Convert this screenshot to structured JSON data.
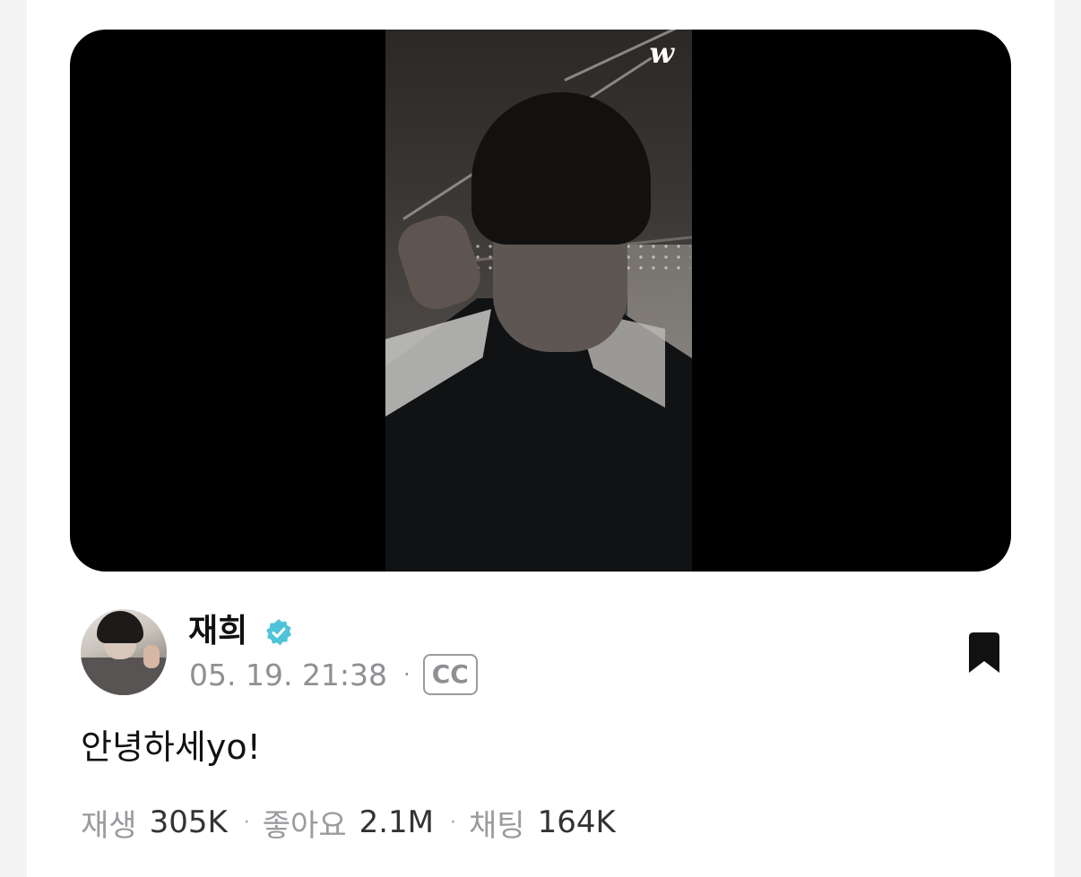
{
  "video": {
    "watermark": "w"
  },
  "post": {
    "author": "재희",
    "verified_icon": "verified-badge-icon",
    "date": "05. 19. 21:38",
    "separator": "·",
    "cc_label": "CC",
    "bookmark_icon": "bookmark-icon",
    "caption": "안녕하세yo!"
  },
  "stats": {
    "plays_label": "재생",
    "plays_value": "305K",
    "likes_label": "좋아요",
    "likes_value": "2.1M",
    "chats_label": "채팅",
    "chats_value": "164K",
    "separator": "·"
  },
  "colors": {
    "verified": "#4fc3d8",
    "text_primary": "#111111",
    "text_secondary": "#8f8f94"
  }
}
